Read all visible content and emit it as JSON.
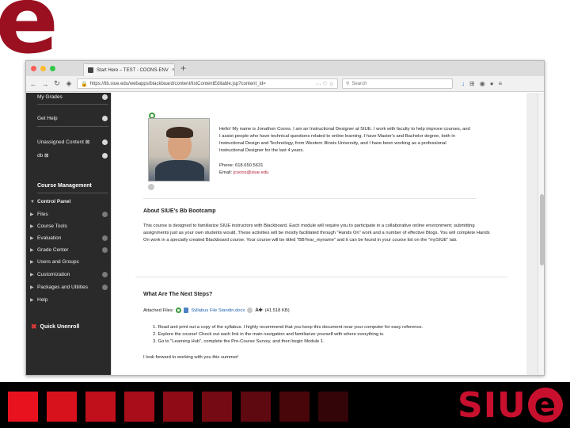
{
  "slide": {
    "corner_letter": "e",
    "logo_text": "SIU",
    "logo_e": "e",
    "square_colors": [
      "#e8121e",
      "#d8121d",
      "#c0101c",
      "#a80e19",
      "#8f0c16",
      "#760a12",
      "#5e080f",
      "#48060b",
      "#330408"
    ]
  },
  "browser": {
    "tab_title": "Start Here – TEST - COONS-ENV",
    "tab_close": "×",
    "new_tab": "+",
    "url": "https://lib.siue.edu/webapps/blackboard/content/listContentEditable.jsp?content_id=",
    "search_placeholder": "Search",
    "colors": {
      "close": "#fc5f57",
      "minimize": "#fdbc2e",
      "maximize": "#33c748"
    }
  },
  "sidebar": {
    "top_items": [
      {
        "label": "My Grades"
      },
      {
        "label": "Get Help"
      },
      {
        "label": "Unassigned Content ⊠"
      },
      {
        "label": "db ⊠"
      }
    ],
    "section_title": "Course Management",
    "control_panel_label": "Control Panel",
    "panel_items": [
      {
        "label": "Files"
      },
      {
        "label": "Course Tools"
      },
      {
        "label": "Evaluation"
      },
      {
        "label": "Grade Center"
      },
      {
        "label": "Users and Groups"
      },
      {
        "label": "Customization"
      },
      {
        "label": "Packages and Utilities"
      },
      {
        "label": "Help"
      }
    ],
    "quick_unenroll": "Quick Unenroll"
  },
  "content": {
    "bio": "Hello! My name is Jonathon Coons. I am an Instructional Designer at SIUE. I work with faculty to help improve courses, and I assist people who have technical questions related to online learning. I have Master's and Bachelor degree, both in Instructional Design and Technology, from Western Illinois University, and I have been working as a professional Instructional Designer for the last 4 years.",
    "phone": "Phone: 618.650.5631",
    "email_label": "Email:",
    "email": "jcoons@siue.edu",
    "about_heading": "About SIUE's Bb Bootcamp",
    "about_text": "This course is designed to familiarize SIUE instructors with Blackboard. Each module will require you to participate in a collaborative online environment; submitting assignments just as your own students would. These activities will be mostly facilitated through \"Hands On\" work and a number of effective Blogs. You will complete Hands On work in a specially created Blackboard course. Your course will be titled \"BBYear_myname\" and it can be found in your course list on the \"mySIUE\" tab.",
    "next_heading": "What Are The Next Steps?",
    "attached_label": "Attached Files:",
    "attached_file": "Syllabus File Standin.docx",
    "attached_size": "(41.518 KB)",
    "steps": [
      "1. Read and print out a copy of the syllabus. I highly recommend that you keep this document near your computer for easy reference.",
      "2. Explore the course! Check out each link in the main navigation and familiarize yourself with where everything is.",
      "3. Go to \"Learning Hub\", complete the Pre-Course Survey, and then begin Module 1."
    ],
    "closing": "I look forward to working with you this summer!"
  }
}
